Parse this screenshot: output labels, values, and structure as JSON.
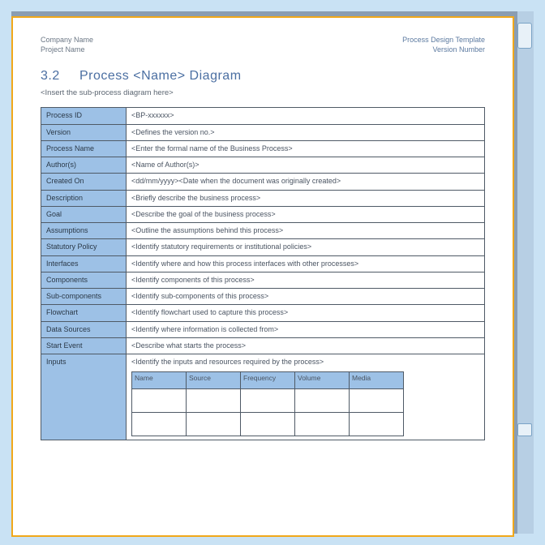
{
  "header": {
    "left_line1": "Company Name",
    "left_line2": "Project Name",
    "right_line1": "Process Design Template",
    "right_line2": "Version Number"
  },
  "section": {
    "number": "3.2",
    "title": "Process <Name> Diagram"
  },
  "subtitle": "<Insert the sub-process diagram here>",
  "rows": [
    {
      "label": "Process ID",
      "value": "<BP-xxxxxx>"
    },
    {
      "label": "Version",
      "value": "<Defines the version no.>"
    },
    {
      "label": "Process Name",
      "value": "<Enter the formal name of the Business Process>"
    },
    {
      "label": "Author(s)",
      "value": "<Name of Author(s)>"
    },
    {
      "label": "Created On",
      "value": "<dd/mm/yyyy><Date when the document was originally created>"
    },
    {
      "label": "Description",
      "value": "<Briefly describe the business process>"
    },
    {
      "label": "Goal",
      "value": "<Describe the goal of the business process>"
    },
    {
      "label": "Assumptions",
      "value": "<Outline the assumptions behind this process>"
    },
    {
      "label": "Statutory Policy",
      "value": "<Identify statutory requirements or institutional policies>"
    },
    {
      "label": "Interfaces",
      "value": "<Identify where and how this process interfaces with other processes>"
    },
    {
      "label": "Components",
      "value": "<Identify components of this process>"
    },
    {
      "label": "Sub-components",
      "value": "<Identify sub-components of this process>"
    },
    {
      "label": "Flowchart",
      "value": "<Identify flowchart used to capture this process>"
    },
    {
      "label": "Data Sources",
      "value": "<Identify where information is collected from>"
    },
    {
      "label": "Start Event",
      "value": "<Describe what starts the process>"
    }
  ],
  "inputs_row": {
    "label": "Inputs",
    "desc": "<Identify the inputs and resources required by the process>",
    "columns": [
      "Name",
      "Source",
      "Frequency",
      "Volume",
      "Media"
    ]
  }
}
